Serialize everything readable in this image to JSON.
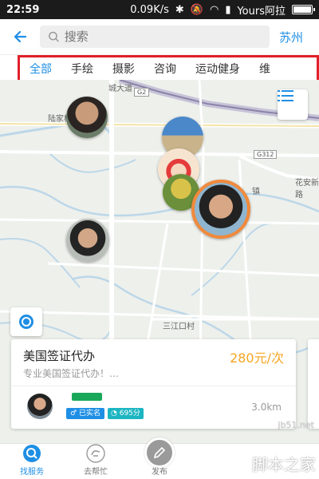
{
  "status_bar": {
    "time": "22:59",
    "network_speed": "0.09K/s",
    "carrier": "Yours阿拉"
  },
  "header": {
    "back_icon": "arrow-left-icon",
    "search_placeholder": "搜索",
    "city": "苏州"
  },
  "tabs": [
    {
      "label": "全部",
      "active": true
    },
    {
      "label": "手绘",
      "active": false
    },
    {
      "label": "摄影",
      "active": false
    },
    {
      "label": "咨询",
      "active": false
    },
    {
      "label": "运动健身",
      "active": false
    },
    {
      "label": "维",
      "active": false
    }
  ],
  "map": {
    "labels": {
      "city_road": "城大道",
      "village": "陆家桥",
      "highway_g2": "G2",
      "highway_g312": "G312",
      "flower_road": "花安新路",
      "town": "镇",
      "sanjiang": "三江口村"
    }
  },
  "card": {
    "title": "美国签证代办",
    "price": "280元/次",
    "description": "专业美国签证代办！…",
    "verified_badge": "已实名",
    "score_badge": "695分",
    "distance": "3.0km"
  },
  "bottom_nav": [
    {
      "label": "找服务",
      "icon": "search-person-icon",
      "active": true
    },
    {
      "label": "去帮忙",
      "icon": "hand-icon",
      "active": false
    },
    {
      "label": "发布",
      "icon": "pencil-icon",
      "active": false
    },
    {
      "label": "",
      "icon": "",
      "active": false
    },
    {
      "label": "",
      "icon": "",
      "active": false
    }
  ],
  "watermark": {
    "url": "jb51.net",
    "text": "脚本之家"
  },
  "colors": {
    "accent": "#1f8fe5",
    "price": "#f5a623",
    "highlight_border": "#e0202a",
    "verified": "#1f8fe5",
    "score": "#1cb5c2"
  }
}
